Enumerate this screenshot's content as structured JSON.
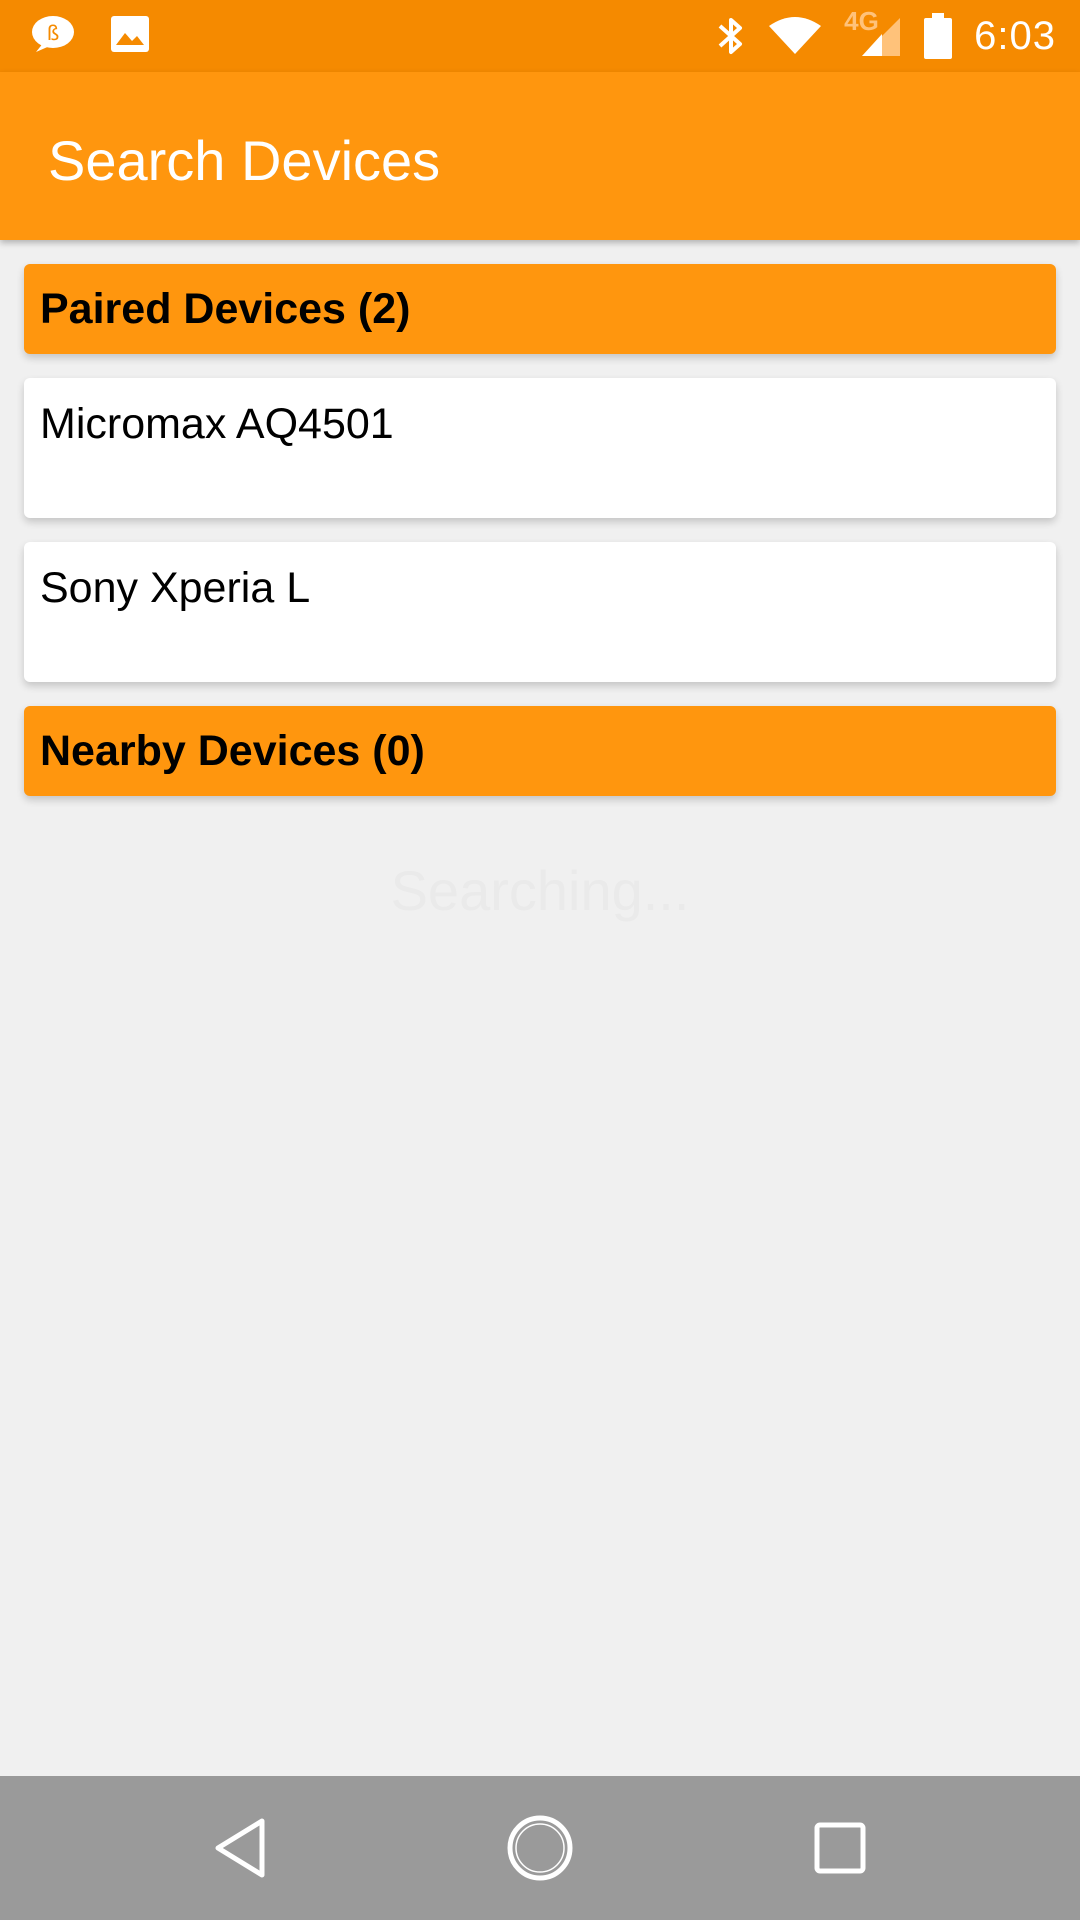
{
  "status_bar": {
    "time": "6:03",
    "network_label": "4G",
    "icons": [
      "chat-icon",
      "image-icon",
      "bluetooth-icon",
      "wifi-icon",
      "signal-icon",
      "battery-icon"
    ]
  },
  "app_bar": {
    "title": "Search Devices"
  },
  "paired": {
    "header": "Paired Devices (2)",
    "devices": [
      {
        "name": "Micromax AQ4501"
      },
      {
        "name": "Sony Xperia L"
      }
    ]
  },
  "nearby": {
    "header": "Nearby Devices (0)",
    "status": "Searching..."
  },
  "nav_bar": {
    "icons": [
      "back-icon",
      "home-icon",
      "recents-icon"
    ]
  },
  "colors": {
    "status_bar": "#f58a00",
    "app_bar": "#ff960e",
    "background": "#f0f0f0",
    "nav_bar": "#9a9a9a"
  }
}
